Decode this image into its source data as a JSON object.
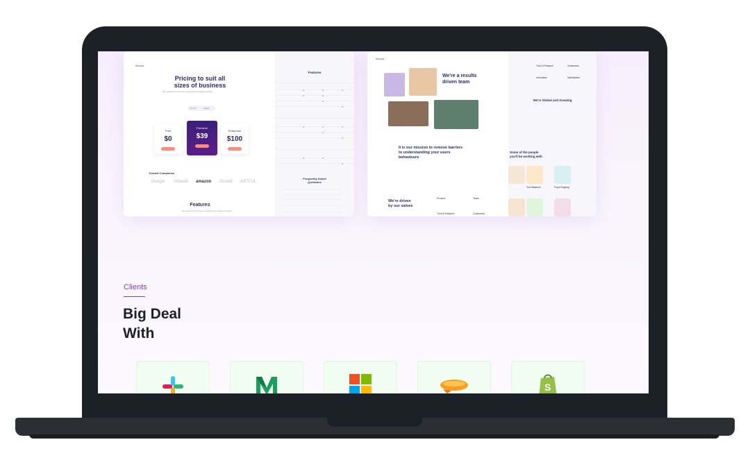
{
  "mockup_pricing": {
    "brand": "Mocosa",
    "title_line1": "Pricing to suit all",
    "title_line2": "sizes of business",
    "subtitle": "Stop wasting time and money designing and managing a website",
    "toggle_monthly": "Monthly",
    "toggle_yearly": "Yearly",
    "plans": [
      {
        "name": "Free",
        "price": "$0"
      },
      {
        "name": "Premium",
        "price": "$39"
      },
      {
        "name": "Enterprise",
        "price": "$100"
      }
    ],
    "trusted_companies": "Trusted Companies",
    "trusted_logos": [
      "Google",
      "Infaweb",
      "amazon",
      "Soundi",
      "ARTFUL"
    ],
    "features_heading": "Features",
    "features_subtitle": "Stop wasting time and money designing and managing a website",
    "right_features_heading": "Features",
    "faq_heading_line1": "Frequently Asked",
    "faq_heading_line2": "Questions"
  },
  "mockup_team": {
    "brand": "Mocosa",
    "title_line1": "We're a results",
    "title_line2": "driven team",
    "mission_line1": "It is our mission to remove barriers",
    "mission_line2": "to understanding your users",
    "mission_line3": "behaviours",
    "values_line1": "We're driven",
    "values_line2": "by our values",
    "values_items": [
      "Product",
      "Team",
      "Trust & Respect",
      "Customers"
    ],
    "right_top_items": [
      "Trust & Respect",
      "Customers",
      "Innovation",
      "Satisfaction"
    ],
    "global_heading": "We're Global and Growing",
    "people_heading_line1": "Some of the people",
    "people_heading_line2": "you'll be working with",
    "people": [
      "Tom Bakbrun",
      "Floyd Dagtoig"
    ]
  },
  "clients": {
    "label": "Clients",
    "heading_line1": "Big Deal",
    "heading_line2": "With",
    "logos": [
      "slack-logo",
      "medium-logo",
      "microsoft-logo",
      "zeppelin-logo",
      "shopify-logo"
    ]
  }
}
